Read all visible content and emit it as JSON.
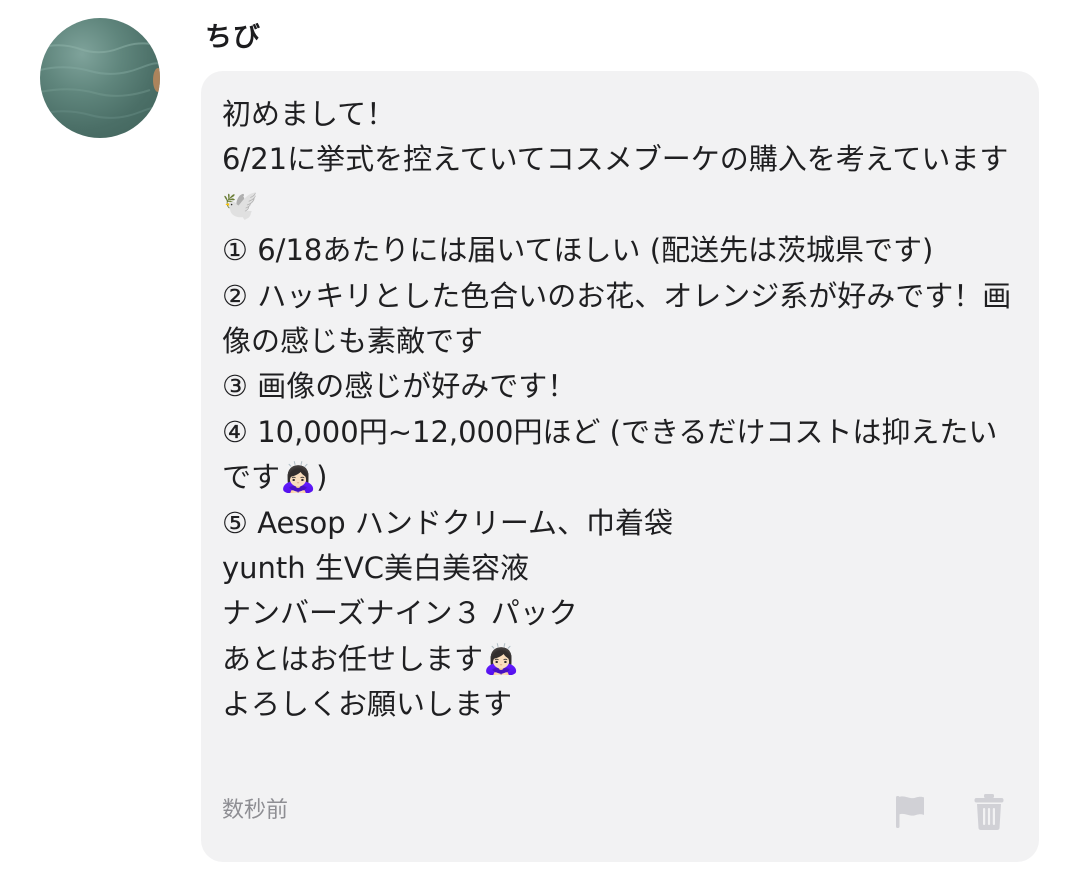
{
  "post": {
    "username": "ちび",
    "message": "初めまして！\n6/21に挙式を控えていてコスメブーケの購入を考えています🕊️\n① 6/18あたりには届いてほしい (配送先は茨城県です)\n② ハッキリとした色合いのお花、オレンジ系が好みです！画像の感じも素敵です\n③ 画像の感じが好みです！\n④ 10,000円~12,000円ほど (できるだけコストは抑えたいです🙇🏻‍♀️)\n⑤ Aesop ハンドクリーム、巾着袋\nyunth 生VC美白美容液\nナンバーズナイン３ パック\nあとはお任せします🙇🏻‍♀️\nよろしくお願いします",
    "timestamp": "数秒前"
  },
  "icons": {
    "avatar": "water-photo-avatar",
    "report": "flag-icon",
    "delete": "trash-icon"
  },
  "colors": {
    "bubble": "#f2f2f3",
    "icon_gray": "#d1d1d6",
    "timestamp": "#8e8e93"
  }
}
